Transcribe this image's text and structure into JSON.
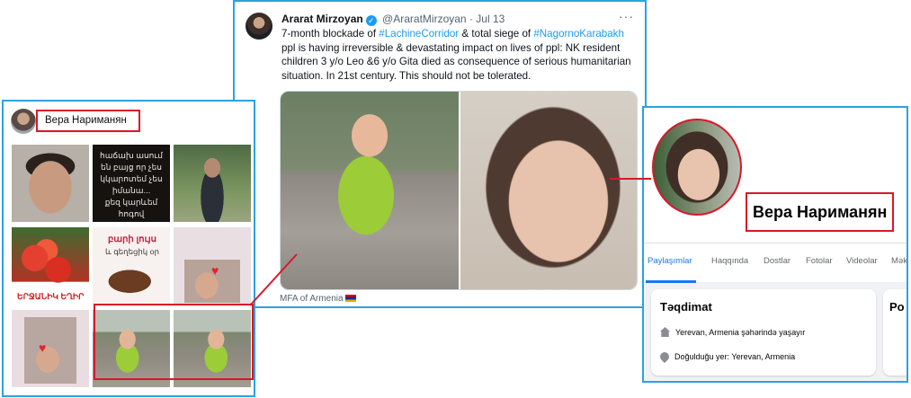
{
  "tweet": {
    "author_name": "Ararat Mirzoyan",
    "verified_mark": "✓",
    "handle": "@AraratMirzoyan",
    "separator": "·",
    "date": "Jul 13",
    "more": "···",
    "text_1": "7-month blockade of ",
    "hashtag_1": "#LachineCorridor",
    "text_2": " & total siege of ",
    "hashtag_2": "#NagornoKarabakh",
    "text_3": " ppl is having irreversible & devastating impact on lives of ppl: NK resident children 3 y/o Leo &6 y/o Gita died as consequence of serious humanitarian situation. In 21st century. This should not be tolerated.",
    "media_caption": "MFA of Armenia",
    "flag_icon": "armenia-flag-icon"
  },
  "left_panel": {
    "profile_name": "Вера Нариманян",
    "posts": {
      "quote_lines": [
        "հաճախ ասում",
        "են բայց որ չես",
        "կկարոտեմ չես",
        "իմանա...",
        "քեզ կարևեմ հոգով"
      ],
      "flowers_text": "ԵՐՋԱՆԻԿ ԵՂԻՐ",
      "greeting_title": "բարի լույս",
      "greeting_sub": "և գեղեցիկ օր",
      "heart_icon": "heart-icon"
    }
  },
  "facebook": {
    "profile_name": "Вера Нариманян",
    "tabs": [
      "Paylaşımlar",
      "Haqqında",
      "Dostlar",
      "Fotolar",
      "Videolar",
      "Mək"
    ],
    "intro_title": "Təqdimat",
    "side_card_title": "Po",
    "location_line": "Yerevan, Armenia şəhərində yaşayır",
    "birthplace_label": "Doğulduğu yer: ",
    "birthplace_value": "Yerevan, Armenia",
    "icons": [
      "home-icon",
      "location-pin-icon"
    ]
  },
  "colors": {
    "frame_blue": "#2aa3e0",
    "highlight_red": "#d8182a",
    "twitter_link": "#1d9bf0",
    "facebook_blue": "#1877f2"
  }
}
